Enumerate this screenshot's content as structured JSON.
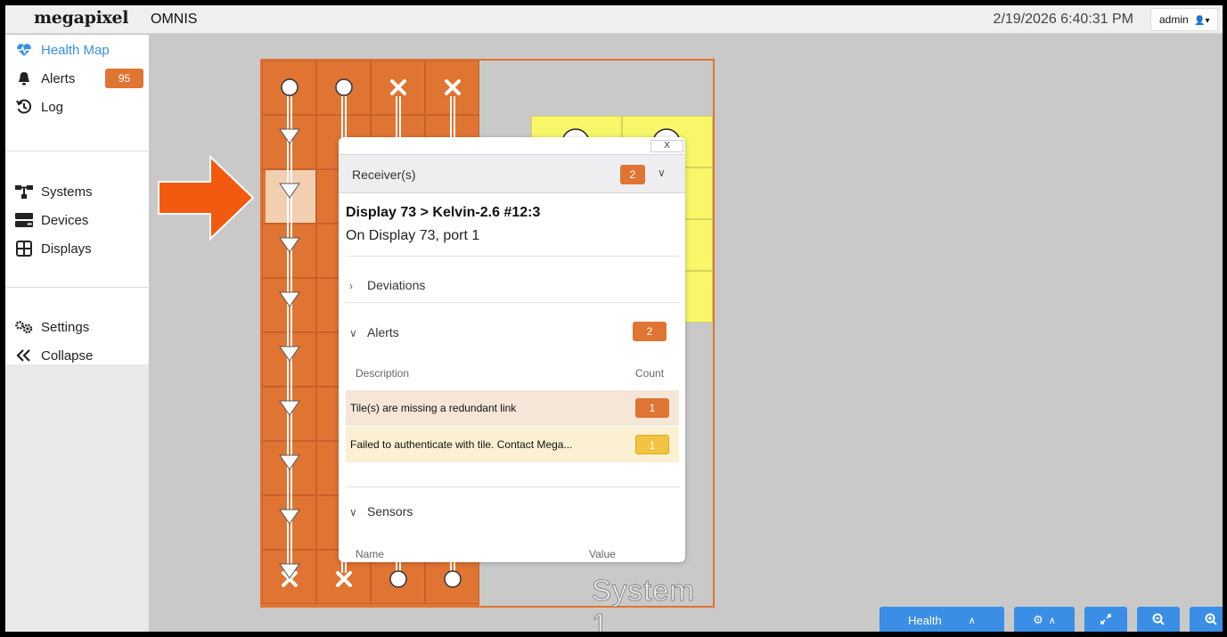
{
  "header": {
    "logo": "megapixel",
    "app_name": "OMNIS",
    "datetime": "2/19/2026 6:40:31 PM",
    "user": "admin"
  },
  "sidebar": {
    "items": [
      {
        "label": "Health Map",
        "icon": "heart-pulse-icon",
        "active": true
      },
      {
        "label": "Alerts",
        "icon": "bell-icon",
        "badge": "95"
      },
      {
        "label": "Log",
        "icon": "history-icon"
      },
      {
        "label": "Systems",
        "icon": "network-icon"
      },
      {
        "label": "Devices",
        "icon": "server-icon"
      },
      {
        "label": "Displays",
        "icon": "grid-icon"
      },
      {
        "label": "Settings",
        "icon": "gears-icon"
      },
      {
        "label": "Collapse",
        "icon": "double-chevron-left-icon"
      }
    ]
  },
  "canvas": {
    "system_label": "System 1"
  },
  "popup": {
    "close_label": "X",
    "receiver_label": "Receiver(s)",
    "receiver_count": "2",
    "title": "Display 73 > Kelvin-2.6 #12:3",
    "subtitle": "On Display 73, port 1",
    "deviations_label": "Deviations",
    "alerts_label": "Alerts",
    "alerts_count": "2",
    "alerts_table": {
      "headers": [
        "Description",
        "Count"
      ],
      "rows": [
        {
          "description": "Tile(s) are missing a redundant link",
          "count": "1",
          "severity": "orange"
        },
        {
          "description": "Failed to authenticate with tile. Contact Mega...",
          "count": "1",
          "severity": "yellow"
        }
      ]
    },
    "sensors_label": "Sensors",
    "sensors_table": {
      "headers": [
        "Name",
        "Value"
      ]
    }
  },
  "toolbar": {
    "health_label": "Health"
  },
  "colors": {
    "accent": "#3b8ee6",
    "orange": "#e07433",
    "yellow": "#f8f76a"
  }
}
